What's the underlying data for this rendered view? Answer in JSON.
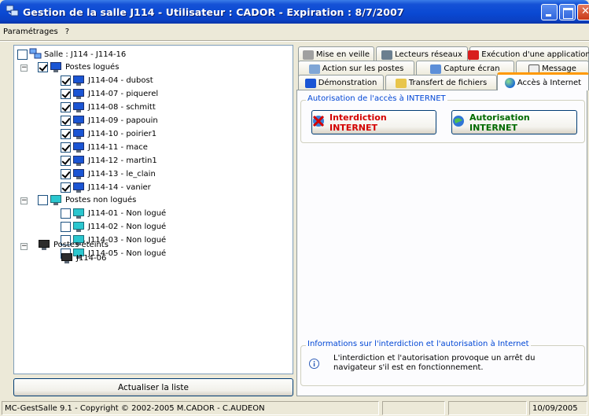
{
  "window": {
    "title": "Gestion de la salle J114 - Utilisateur : CADOR - Expiration  : 8/7/2007"
  },
  "menu": {
    "items": [
      "Paramétrages",
      "?"
    ]
  },
  "tree": {
    "root_label": "Salle : J114 - J114-16",
    "groups": [
      {
        "label": "Postes logués",
        "items": [
          "J114-04 - dubost",
          "J114-07 - piquerel",
          "J114-08 - schmitt",
          "J114-09 - papouin",
          "J114-10 - poirier1",
          "J114-11 - mace",
          "J114-12 - martin1",
          "J114-13 - le_clain",
          "J114-14 - vanier"
        ]
      },
      {
        "label": "Postes non logués",
        "items": [
          "J114-01 - Non logué",
          "J114-02 - Non logué",
          "J114-03 - Non logué",
          "J114-05 - Non logué"
        ]
      },
      {
        "label": "Postes éteints",
        "items": [
          "J114-06"
        ]
      }
    ]
  },
  "refresh_button": {
    "label": "Actualiser la liste"
  },
  "tabs": {
    "row1": [
      "Mise en veille",
      "Lecteurs réseaux",
      "Exécution d'une application"
    ],
    "row2": [
      "Action sur les postes",
      "Capture écran",
      "Message"
    ],
    "row3": [
      "Démonstration",
      "Transfert de fichiers",
      "Accès à Internet"
    ],
    "active": "Accès à Internet"
  },
  "internet_group": {
    "title": "Autorisation de l'accès à INTERNET",
    "deny_label": "Interdiction INTERNET",
    "allow_label": "Autorisation INTERNET"
  },
  "info_group": {
    "title": "Informations sur l'interdiction et l'autorisation à Internet",
    "text": "L'interdiction et l'autorisation provoque un arrêt du navigateur s'il est en fonctionnement."
  },
  "status": {
    "copyright": "MC-GestSalle 9.1 - Copyright © 2002-2005  M.CADOR - C.AUDEON",
    "date": "10/09/2005"
  },
  "colors": {
    "titlebar": "#0a49d3",
    "group_title": "#0046d5",
    "deny_text": "#d40000",
    "allow_text": "#006a00",
    "active_tab_accent": "#ff9900"
  }
}
